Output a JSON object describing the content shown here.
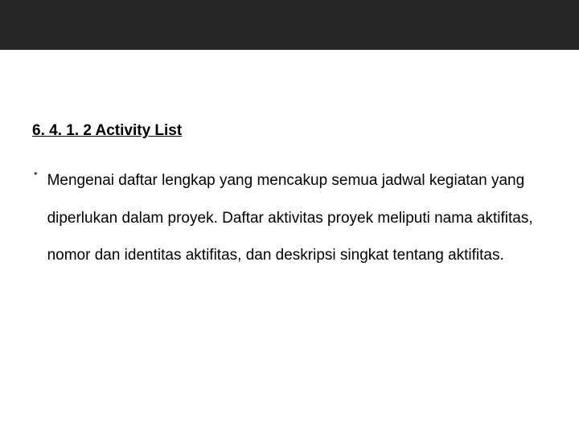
{
  "heading": "6. 4. 1. 2 Activity List",
  "bullet": "•",
  "body": "Mengenai daftar lengkap yang mencakup semua jadwal kegiatan yang diperlukan dalam proyek. Daftar aktivitas proyek meliputi nama aktifitas, nomor dan identitas aktifitas, dan deskripsi singkat tentang aktifitas."
}
